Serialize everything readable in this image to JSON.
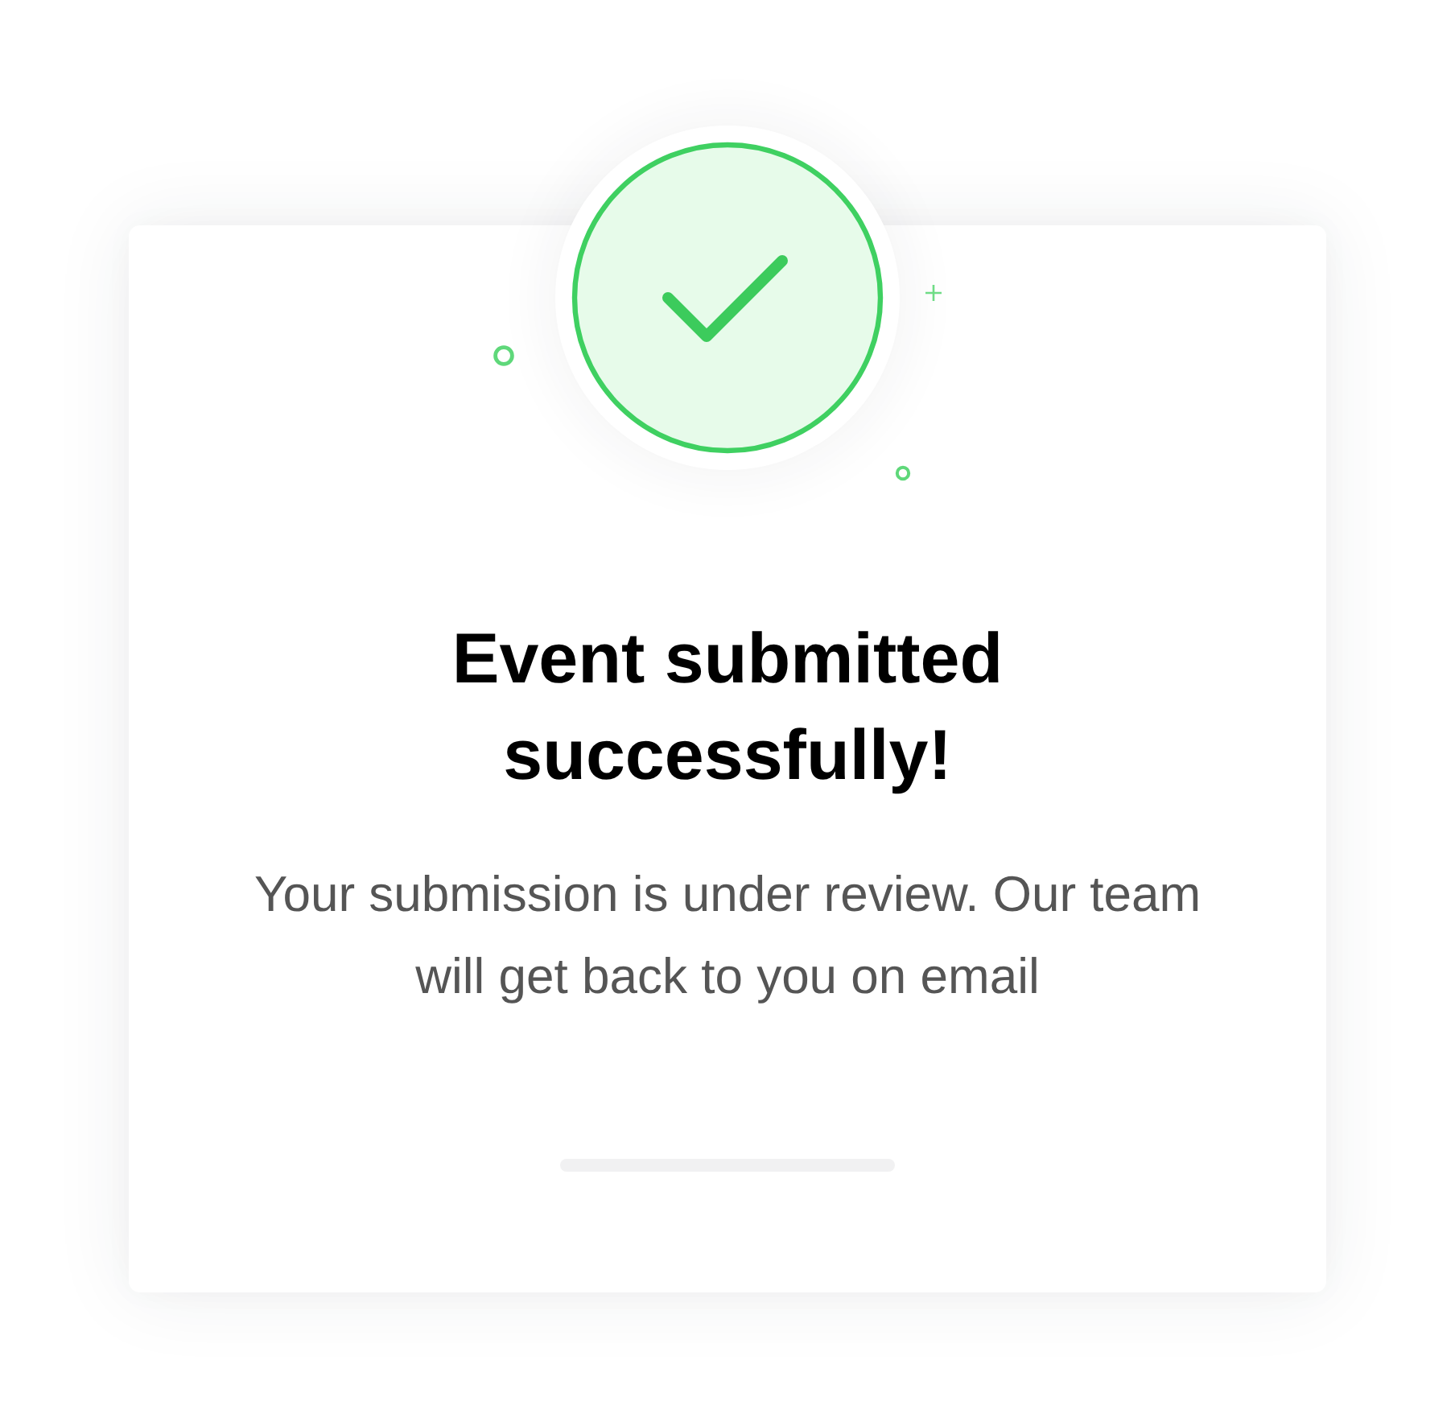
{
  "dialog": {
    "title": "Event submitted successfully!",
    "message": "Your submission is under review. Our team will get back to you on email"
  }
}
